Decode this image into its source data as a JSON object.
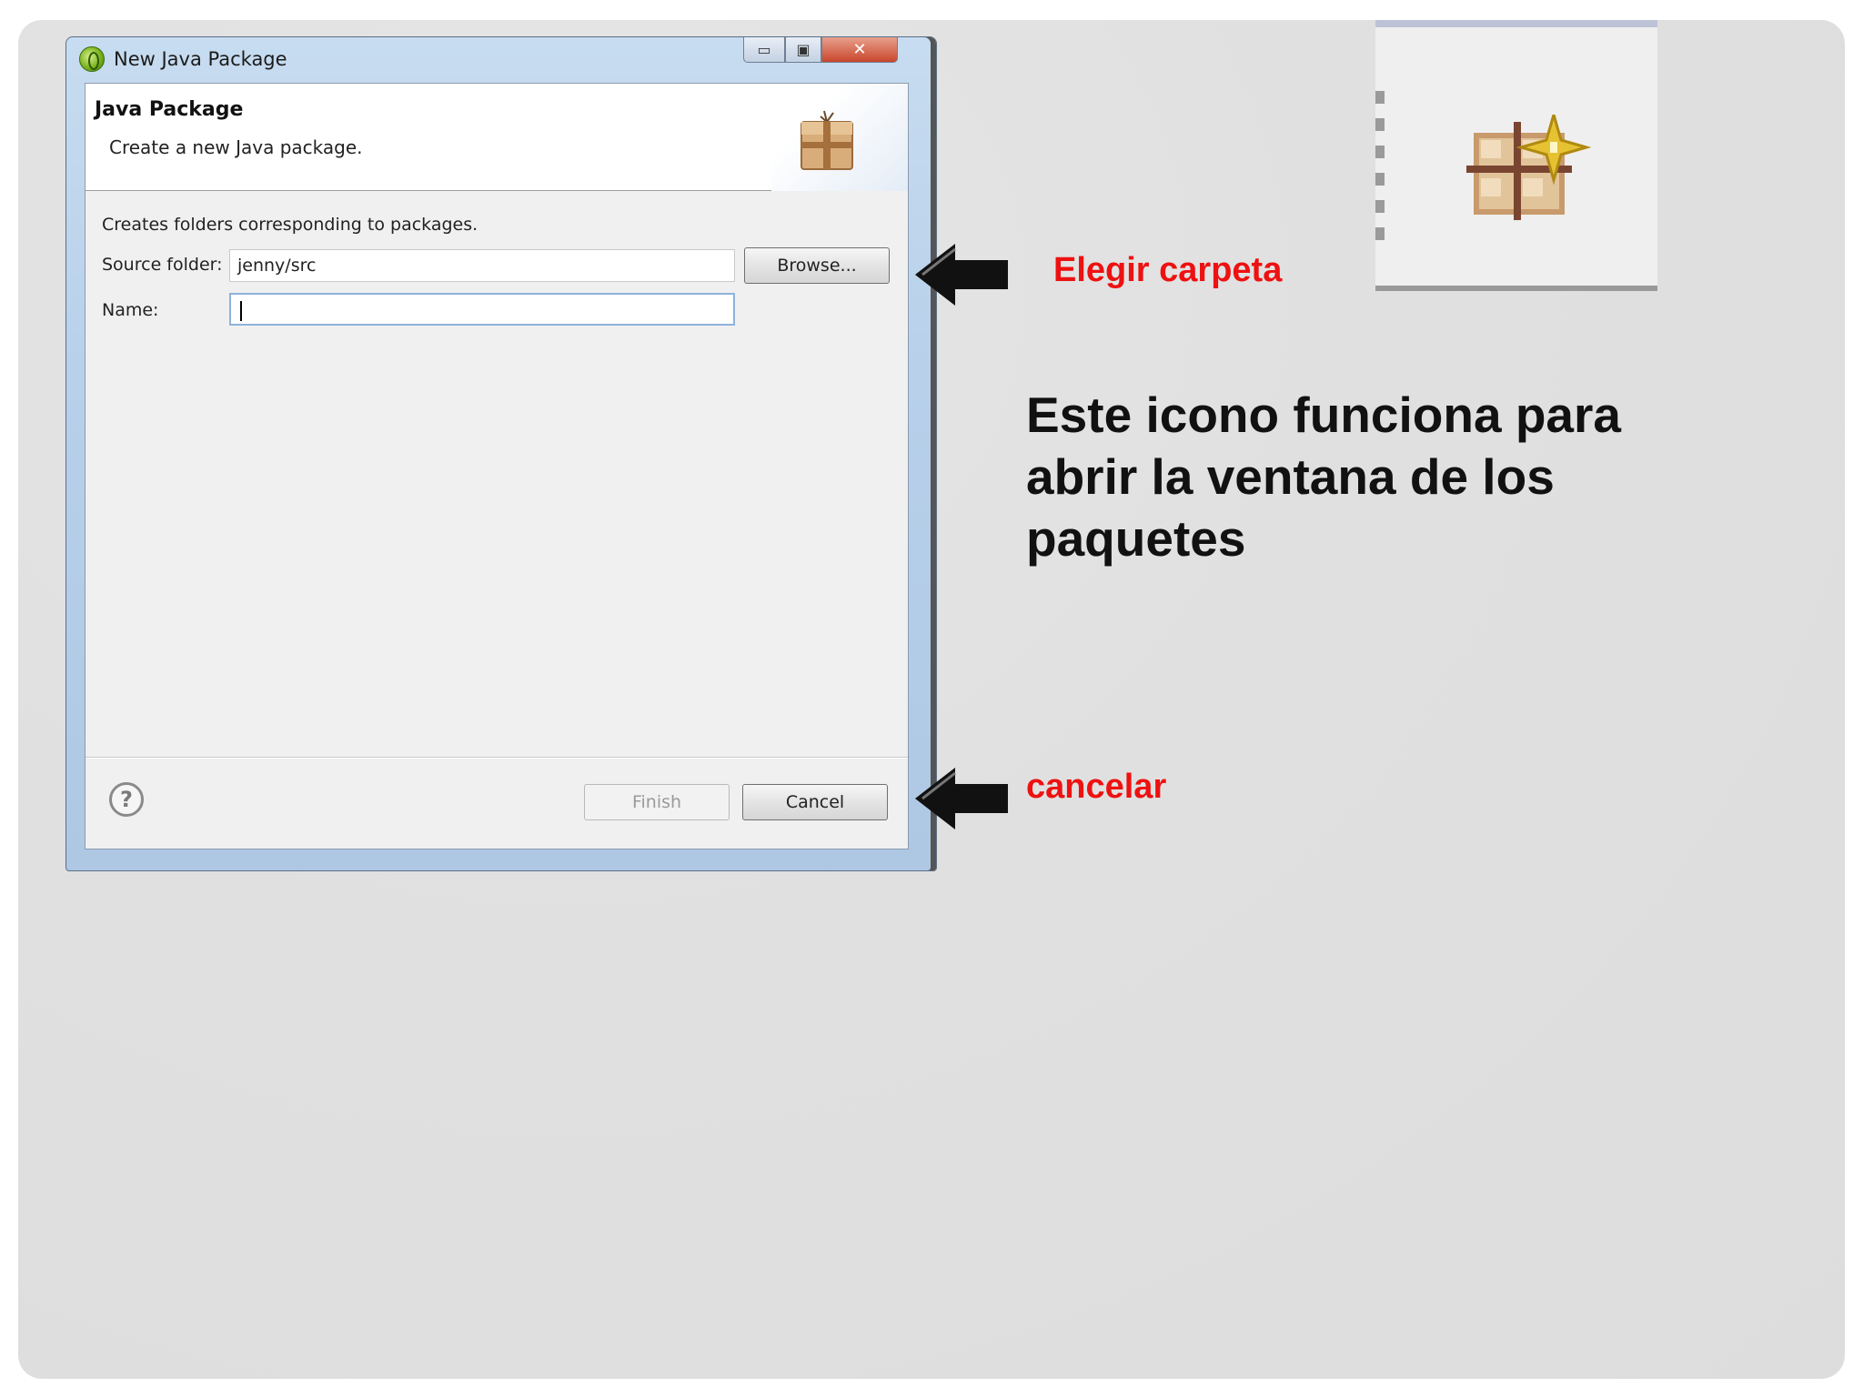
{
  "dialog": {
    "window_title": "New Java Package",
    "minimize_glyph": "▭",
    "maximize_glyph": "▣",
    "close_glyph": "✕",
    "banner_title": "Java Package",
    "banner_subtitle": "Create a new Java package.",
    "description": "Creates folders corresponding to packages.",
    "source_folder_label": "Source folder:",
    "source_folder_value": "jenny/src",
    "browse_label": "Browse...",
    "name_label": "Name:",
    "name_value": "",
    "help_glyph": "?",
    "finish_label": "Finish",
    "cancel_label": "Cancel"
  },
  "annotations": {
    "browse_note": "Elegir carpeta",
    "cancel_note": "cancelar",
    "explanation": "Este icono funciona para abrir la ventana de los paquetes"
  },
  "icons": {
    "app": "eclipse-icon",
    "banner": "package-icon",
    "zoomed": "new-package-icon",
    "arrows": "arrow-left-icon"
  },
  "colors": {
    "annotation_red": "#ee1111",
    "explanation_text": "#111111",
    "slide_background": "#e0e0e0"
  }
}
